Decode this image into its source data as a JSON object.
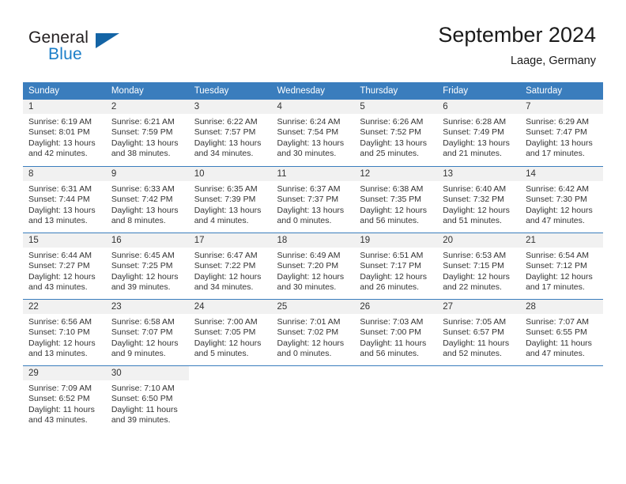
{
  "brand": {
    "name_top": "General",
    "name_bottom": "Blue",
    "triangle_color": "#1464a5",
    "blue_color": "#1a7ec8"
  },
  "header": {
    "title": "September 2024",
    "location": "Laage, Germany"
  },
  "theme": {
    "header_row_bg": "#3a7dbd",
    "daynum_bg": "#f1f1f1",
    "text": "#333333",
    "page_bg": "#ffffff"
  },
  "calendar": {
    "weekday_headers": [
      "Sunday",
      "Monday",
      "Tuesday",
      "Wednesday",
      "Thursday",
      "Friday",
      "Saturday"
    ],
    "weeks": [
      [
        {
          "day": "1",
          "sunrise": "Sunrise: 6:19 AM",
          "sunset": "Sunset: 8:01 PM",
          "daylight1": "Daylight: 13 hours",
          "daylight2": "and 42 minutes."
        },
        {
          "day": "2",
          "sunrise": "Sunrise: 6:21 AM",
          "sunset": "Sunset: 7:59 PM",
          "daylight1": "Daylight: 13 hours",
          "daylight2": "and 38 minutes."
        },
        {
          "day": "3",
          "sunrise": "Sunrise: 6:22 AM",
          "sunset": "Sunset: 7:57 PM",
          "daylight1": "Daylight: 13 hours",
          "daylight2": "and 34 minutes."
        },
        {
          "day": "4",
          "sunrise": "Sunrise: 6:24 AM",
          "sunset": "Sunset: 7:54 PM",
          "daylight1": "Daylight: 13 hours",
          "daylight2": "and 30 minutes."
        },
        {
          "day": "5",
          "sunrise": "Sunrise: 6:26 AM",
          "sunset": "Sunset: 7:52 PM",
          "daylight1": "Daylight: 13 hours",
          "daylight2": "and 25 minutes."
        },
        {
          "day": "6",
          "sunrise": "Sunrise: 6:28 AM",
          "sunset": "Sunset: 7:49 PM",
          "daylight1": "Daylight: 13 hours",
          "daylight2": "and 21 minutes."
        },
        {
          "day": "7",
          "sunrise": "Sunrise: 6:29 AM",
          "sunset": "Sunset: 7:47 PM",
          "daylight1": "Daylight: 13 hours",
          "daylight2": "and 17 minutes."
        }
      ],
      [
        {
          "day": "8",
          "sunrise": "Sunrise: 6:31 AM",
          "sunset": "Sunset: 7:44 PM",
          "daylight1": "Daylight: 13 hours",
          "daylight2": "and 13 minutes."
        },
        {
          "day": "9",
          "sunrise": "Sunrise: 6:33 AM",
          "sunset": "Sunset: 7:42 PM",
          "daylight1": "Daylight: 13 hours",
          "daylight2": "and 8 minutes."
        },
        {
          "day": "10",
          "sunrise": "Sunrise: 6:35 AM",
          "sunset": "Sunset: 7:39 PM",
          "daylight1": "Daylight: 13 hours",
          "daylight2": "and 4 minutes."
        },
        {
          "day": "11",
          "sunrise": "Sunrise: 6:37 AM",
          "sunset": "Sunset: 7:37 PM",
          "daylight1": "Daylight: 13 hours",
          "daylight2": "and 0 minutes."
        },
        {
          "day": "12",
          "sunrise": "Sunrise: 6:38 AM",
          "sunset": "Sunset: 7:35 PM",
          "daylight1": "Daylight: 12 hours",
          "daylight2": "and 56 minutes."
        },
        {
          "day": "13",
          "sunrise": "Sunrise: 6:40 AM",
          "sunset": "Sunset: 7:32 PM",
          "daylight1": "Daylight: 12 hours",
          "daylight2": "and 51 minutes."
        },
        {
          "day": "14",
          "sunrise": "Sunrise: 6:42 AM",
          "sunset": "Sunset: 7:30 PM",
          "daylight1": "Daylight: 12 hours",
          "daylight2": "and 47 minutes."
        }
      ],
      [
        {
          "day": "15",
          "sunrise": "Sunrise: 6:44 AM",
          "sunset": "Sunset: 7:27 PM",
          "daylight1": "Daylight: 12 hours",
          "daylight2": "and 43 minutes."
        },
        {
          "day": "16",
          "sunrise": "Sunrise: 6:45 AM",
          "sunset": "Sunset: 7:25 PM",
          "daylight1": "Daylight: 12 hours",
          "daylight2": "and 39 minutes."
        },
        {
          "day": "17",
          "sunrise": "Sunrise: 6:47 AM",
          "sunset": "Sunset: 7:22 PM",
          "daylight1": "Daylight: 12 hours",
          "daylight2": "and 34 minutes."
        },
        {
          "day": "18",
          "sunrise": "Sunrise: 6:49 AM",
          "sunset": "Sunset: 7:20 PM",
          "daylight1": "Daylight: 12 hours",
          "daylight2": "and 30 minutes."
        },
        {
          "day": "19",
          "sunrise": "Sunrise: 6:51 AM",
          "sunset": "Sunset: 7:17 PM",
          "daylight1": "Daylight: 12 hours",
          "daylight2": "and 26 minutes."
        },
        {
          "day": "20",
          "sunrise": "Sunrise: 6:53 AM",
          "sunset": "Sunset: 7:15 PM",
          "daylight1": "Daylight: 12 hours",
          "daylight2": "and 22 minutes."
        },
        {
          "day": "21",
          "sunrise": "Sunrise: 6:54 AM",
          "sunset": "Sunset: 7:12 PM",
          "daylight1": "Daylight: 12 hours",
          "daylight2": "and 17 minutes."
        }
      ],
      [
        {
          "day": "22",
          "sunrise": "Sunrise: 6:56 AM",
          "sunset": "Sunset: 7:10 PM",
          "daylight1": "Daylight: 12 hours",
          "daylight2": "and 13 minutes."
        },
        {
          "day": "23",
          "sunrise": "Sunrise: 6:58 AM",
          "sunset": "Sunset: 7:07 PM",
          "daylight1": "Daylight: 12 hours",
          "daylight2": "and 9 minutes."
        },
        {
          "day": "24",
          "sunrise": "Sunrise: 7:00 AM",
          "sunset": "Sunset: 7:05 PM",
          "daylight1": "Daylight: 12 hours",
          "daylight2": "and 5 minutes."
        },
        {
          "day": "25",
          "sunrise": "Sunrise: 7:01 AM",
          "sunset": "Sunset: 7:02 PM",
          "daylight1": "Daylight: 12 hours",
          "daylight2": "and 0 minutes."
        },
        {
          "day": "26",
          "sunrise": "Sunrise: 7:03 AM",
          "sunset": "Sunset: 7:00 PM",
          "daylight1": "Daylight: 11 hours",
          "daylight2": "and 56 minutes."
        },
        {
          "day": "27",
          "sunrise": "Sunrise: 7:05 AM",
          "sunset": "Sunset: 6:57 PM",
          "daylight1": "Daylight: 11 hours",
          "daylight2": "and 52 minutes."
        },
        {
          "day": "28",
          "sunrise": "Sunrise: 7:07 AM",
          "sunset": "Sunset: 6:55 PM",
          "daylight1": "Daylight: 11 hours",
          "daylight2": "and 47 minutes."
        }
      ],
      [
        {
          "day": "29",
          "sunrise": "Sunrise: 7:09 AM",
          "sunset": "Sunset: 6:52 PM",
          "daylight1": "Daylight: 11 hours",
          "daylight2": "and 43 minutes."
        },
        {
          "day": "30",
          "sunrise": "Sunrise: 7:10 AM",
          "sunset": "Sunset: 6:50 PM",
          "daylight1": "Daylight: 11 hours",
          "daylight2": "and 39 minutes."
        },
        {
          "day": "",
          "sunrise": "",
          "sunset": "",
          "daylight1": "",
          "daylight2": ""
        },
        {
          "day": "",
          "sunrise": "",
          "sunset": "",
          "daylight1": "",
          "daylight2": ""
        },
        {
          "day": "",
          "sunrise": "",
          "sunset": "",
          "daylight1": "",
          "daylight2": ""
        },
        {
          "day": "",
          "sunrise": "",
          "sunset": "",
          "daylight1": "",
          "daylight2": ""
        },
        {
          "day": "",
          "sunrise": "",
          "sunset": "",
          "daylight1": "",
          "daylight2": ""
        }
      ]
    ]
  }
}
